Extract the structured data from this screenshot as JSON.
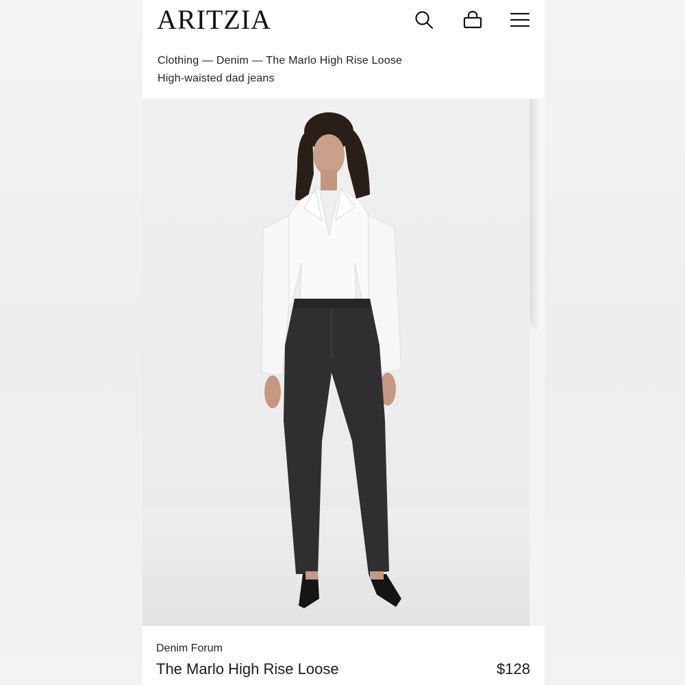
{
  "header": {
    "logo": "ARITZIA",
    "icons": [
      "search-icon",
      "bag-icon",
      "menu-icon"
    ]
  },
  "breadcrumb": {
    "items": [
      "Clothing",
      "Denim",
      "The Marlo High Rise Loose"
    ],
    "separator": "—"
  },
  "subtitle": "High-waisted dad jeans",
  "product": {
    "brand": "Denim Forum",
    "name": "The Marlo High Rise Loose",
    "price": "$128"
  },
  "colors": {
    "background": "#ffffff",
    "text": "#1a1a1a",
    "denim": "#2f2f31",
    "shirt": "#fafafa"
  }
}
